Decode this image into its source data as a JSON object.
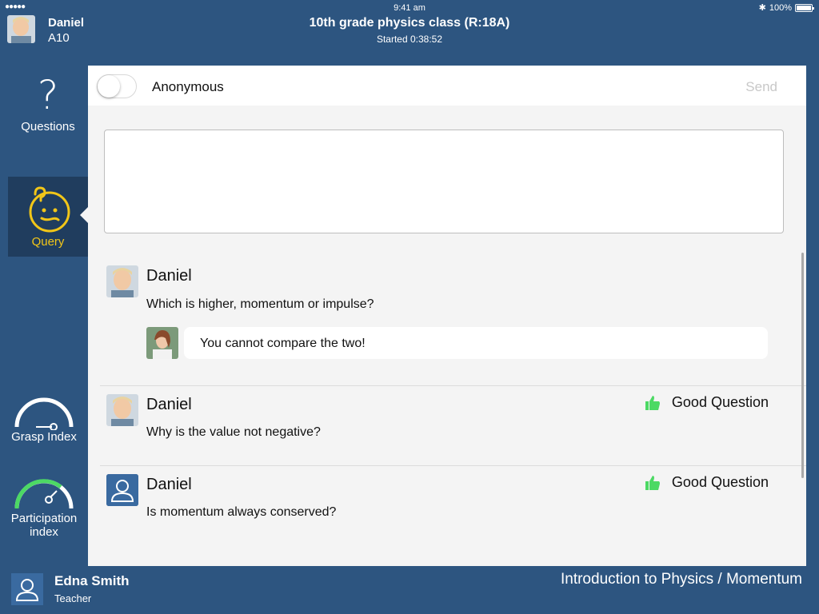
{
  "status_bar": {
    "signal": "●●●●●",
    "time": "9:41 am",
    "battery": "100%"
  },
  "header": {
    "user_name": "Daniel",
    "user_seat": "A10",
    "class_title": "10th grade physics class (R:18A)",
    "started": "Started 0:38:52"
  },
  "sidebar": {
    "items": [
      {
        "label": "Questions",
        "icon": "question-mark-icon",
        "active": false
      },
      {
        "label": "Query",
        "icon": "confused-face-icon",
        "active": true
      },
      {
        "label": "Grasp Index",
        "icon": "gauge-icon",
        "level": 0
      },
      {
        "label": "Participation index",
        "icon": "gauge-icon",
        "level": 0.5
      }
    ],
    "colors": {
      "active_bg": "#203d5e",
      "active_fg": "#f2c618",
      "gauge_green": "#4cd964"
    }
  },
  "compose": {
    "anonymous_label": "Anonymous",
    "anonymous_on": false,
    "send_label": "Send",
    "input_value": ""
  },
  "questions": [
    {
      "author": "Daniel",
      "text": "Which is higher, momentum or impulse?",
      "reply": "You cannot compare the two!",
      "good_question": ""
    },
    {
      "author": "Daniel",
      "text": "Why is the value not negative?",
      "good_question": "Good Question"
    },
    {
      "author": "Daniel",
      "text": "Is momentum always conserved?",
      "good_question": "Good Question"
    }
  ],
  "footer": {
    "teacher_name": "Edna Smith",
    "teacher_role": "Teacher",
    "breadcrumb": "Introduction to Physics / Momentum"
  },
  "colors": {
    "chrome": "#2d5580",
    "panel": "#f4f4f4",
    "thumbs_up": "#4cd964"
  }
}
